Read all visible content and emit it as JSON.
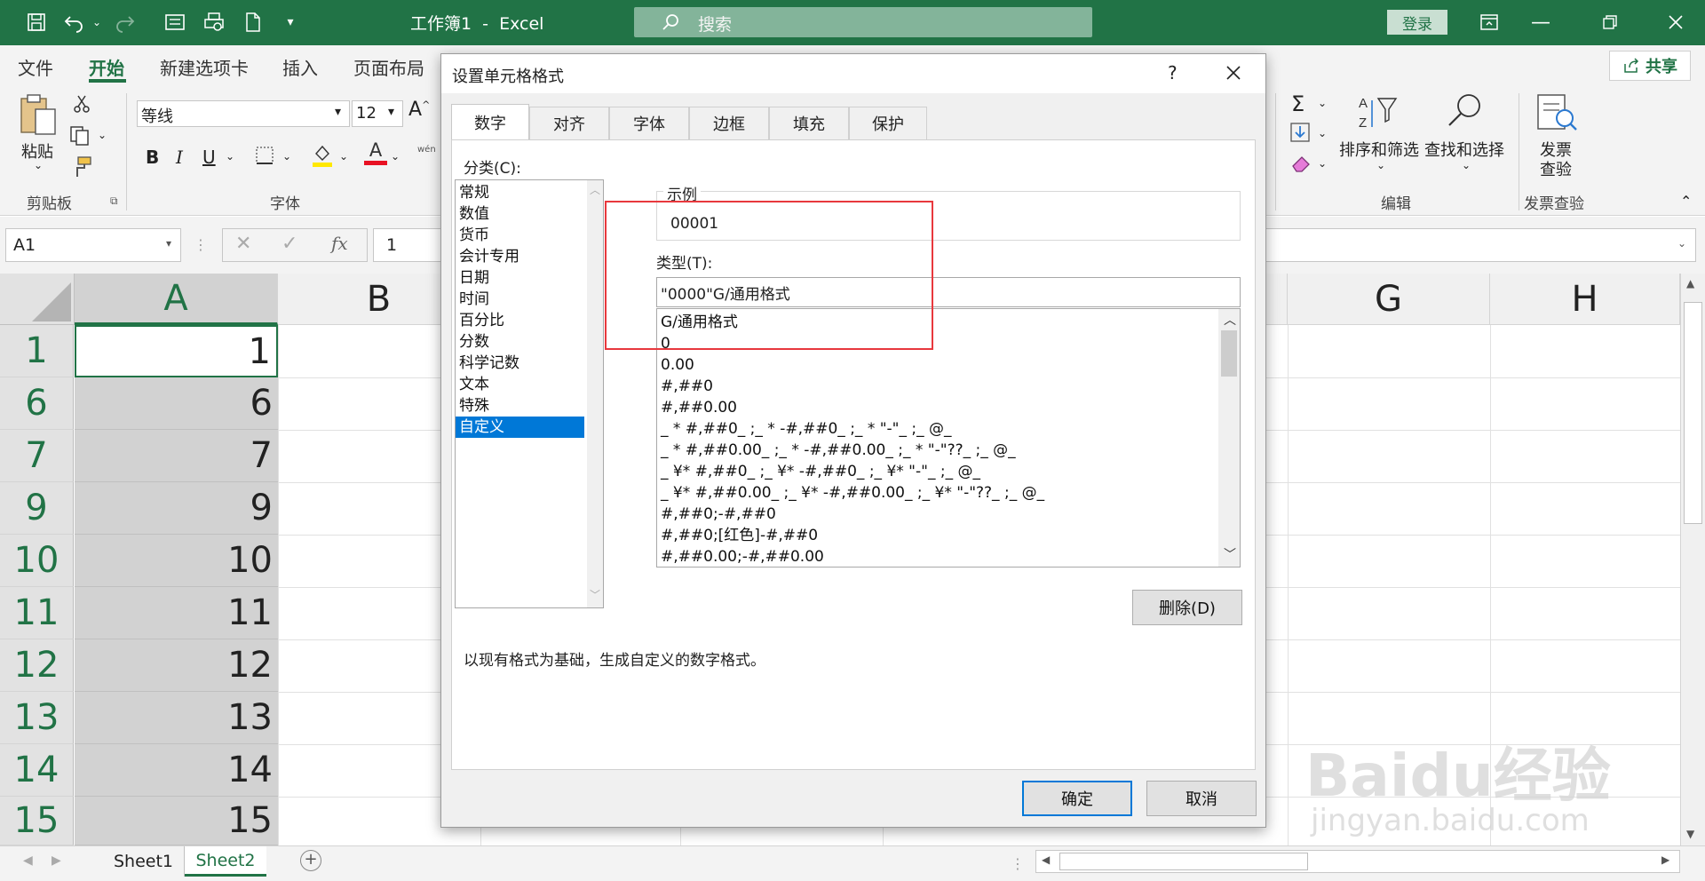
{
  "title_bar": {
    "doc_title": "工作簿1  -  Excel",
    "search_placeholder": "搜索",
    "login_label": "登录"
  },
  "ribbon_tabs": [
    "文件",
    "开始",
    "新建选项卡",
    "插入",
    "页面布局"
  ],
  "share_label": "共享",
  "ribbon": {
    "paste_label": "粘贴",
    "clipboard_label": "剪贴板",
    "font_name": "等线",
    "font_size": "12",
    "font_group_label": "字体",
    "sort_filter_label": "排序和筛选",
    "find_select_label": "查找和选择",
    "edit_group_label": "编辑",
    "invoice_label_1": "发票",
    "invoice_label_2": "查验",
    "invoice_group_label": "发票查验",
    "phonetic_label": "wén"
  },
  "formula_bar": {
    "name_box": "A1",
    "fx": "fx",
    "value": "1"
  },
  "sheet": {
    "columns": [
      "A",
      "B",
      "G",
      "H"
    ],
    "rows": [
      {
        "num": "1",
        "value": "1"
      },
      {
        "num": "6",
        "value": "6"
      },
      {
        "num": "7",
        "value": "7"
      },
      {
        "num": "9",
        "value": "9"
      },
      {
        "num": "10",
        "value": "10"
      },
      {
        "num": "11",
        "value": "11"
      },
      {
        "num": "12",
        "value": "12"
      },
      {
        "num": "13",
        "value": "13"
      },
      {
        "num": "14",
        "value": "14"
      },
      {
        "num": "15",
        "value": "15"
      }
    ],
    "tabs": [
      "Sheet1",
      "Sheet2"
    ],
    "active_tab": "Sheet2"
  },
  "dialog": {
    "title": "设置单元格格式",
    "help": "?",
    "tabs": [
      "数字",
      "对齐",
      "字体",
      "边框",
      "填充",
      "保护"
    ],
    "category_label": "分类(C):",
    "categories": [
      "常规",
      "数值",
      "货币",
      "会计专用",
      "日期",
      "时间",
      "百分比",
      "分数",
      "科学记数",
      "文本",
      "特殊",
      "自定义"
    ],
    "selected_category": "自定义",
    "sample_label": "示例",
    "sample_value": "00001",
    "type_label": "类型(T):",
    "type_value": "\"0000\"G/通用格式",
    "formats": [
      "G/通用格式",
      "0",
      "0.00",
      "#,##0",
      "#,##0.00",
      "_ * #,##0_ ;_ * -#,##0_ ;_ * \"-\"_ ;_ @_",
      "_ * #,##0.00_ ;_ * -#,##0.00_ ;_ * \"-\"??_ ;_ @_",
      "_ ¥* #,##0_ ;_ ¥* -#,##0_ ;_ ¥* \"-\"_ ;_ @_",
      "_ ¥* #,##0.00_ ;_ ¥* -#,##0.00_ ;_ ¥* \"-\"??_ ;_ @_",
      "#,##0;-#,##0",
      "#,##0;[红色]-#,##0",
      "#,##0.00;-#,##0.00"
    ],
    "delete_label": "删除(D)",
    "description": "以现有格式为基础，生成自定义的数字格式。",
    "ok_label": "确定",
    "cancel_label": "取消"
  },
  "highlight_color": "#e8383d",
  "accent_color": "#217346",
  "watermark": {
    "brand": "Baidu经验",
    "url": "jingyan.baidu.com"
  }
}
